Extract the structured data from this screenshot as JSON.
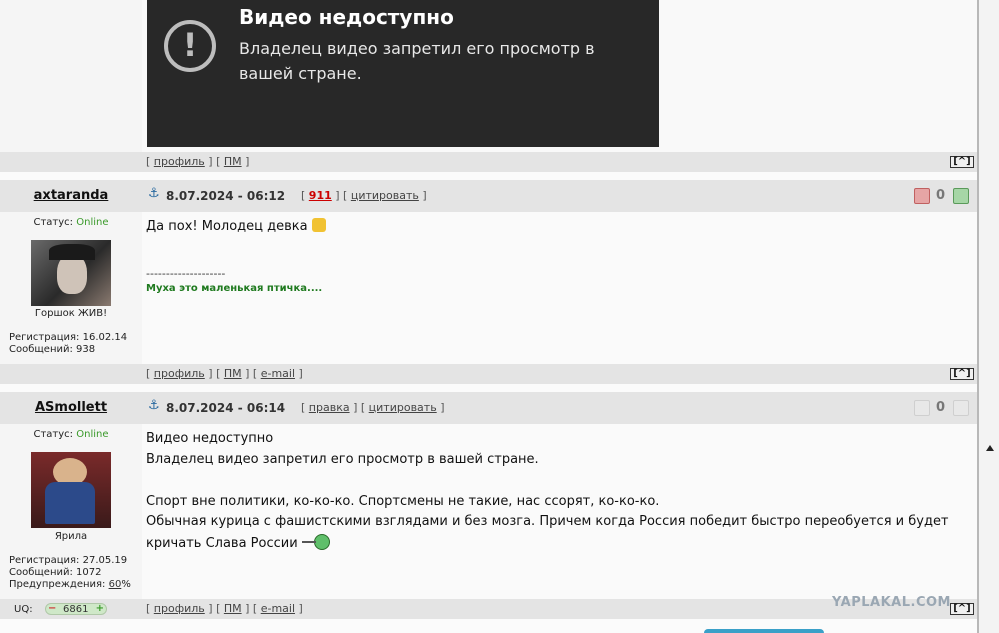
{
  "video": {
    "title": "Видео недоступно",
    "message_line1": "Владелец видео запретил его просмотр в",
    "message_line2": "вашей стране."
  },
  "links": {
    "profile": "профиль",
    "pm": "ПМ",
    "email": "e-mail",
    "quote": "цитировать",
    "up": "[^]"
  },
  "post1": {
    "author": "axtaranda",
    "status_label": "Статус:",
    "status": "Online",
    "avatar_caption": "Горшок ЖИВ!",
    "registration": "Регистрация: 16.02.14",
    "messages": "Сообщений: 938",
    "datetime": "8.07.2024 - 06:12",
    "post_number": "911",
    "rating": "0",
    "text": "Да пох! Молодец девка",
    "signature_sep": "--------------------",
    "signature": "Муха это маленькая птичка...."
  },
  "post2": {
    "author": "ASmollett",
    "status_label": "Статус:",
    "status": "Online",
    "avatar_caption": "Ярила",
    "registration": "Регистрация: 27.05.19",
    "messages": "Сообщений: 1072",
    "warnings_label": "Предупреждения:",
    "warnings_value": "60",
    "warnings_suffix": "%",
    "datetime": "8.07.2024 - 06:14",
    "complaint": "правка",
    "rating": "0",
    "lines": [
      "Видео недоступно",
      "Владелец видео запретил его просмотр в вашей стране.",
      "Спорт вне политики, ко-ко-ко. Спортсмены не такие, нас ссорят, ко-ко-ко.",
      "Обычная курица с фашистскими взглядами и без мозга. Причем когда Россия победит быстро переобуется и будет",
      "кричать Слава России"
    ],
    "uq_label": "UQ:",
    "uq_value": "6861"
  },
  "watermark": "YAPLAKAL.COM",
  "colors": {
    "accent_link": "#cc0000",
    "online": "#3a9a2a",
    "signature": "#1f7a1f"
  }
}
